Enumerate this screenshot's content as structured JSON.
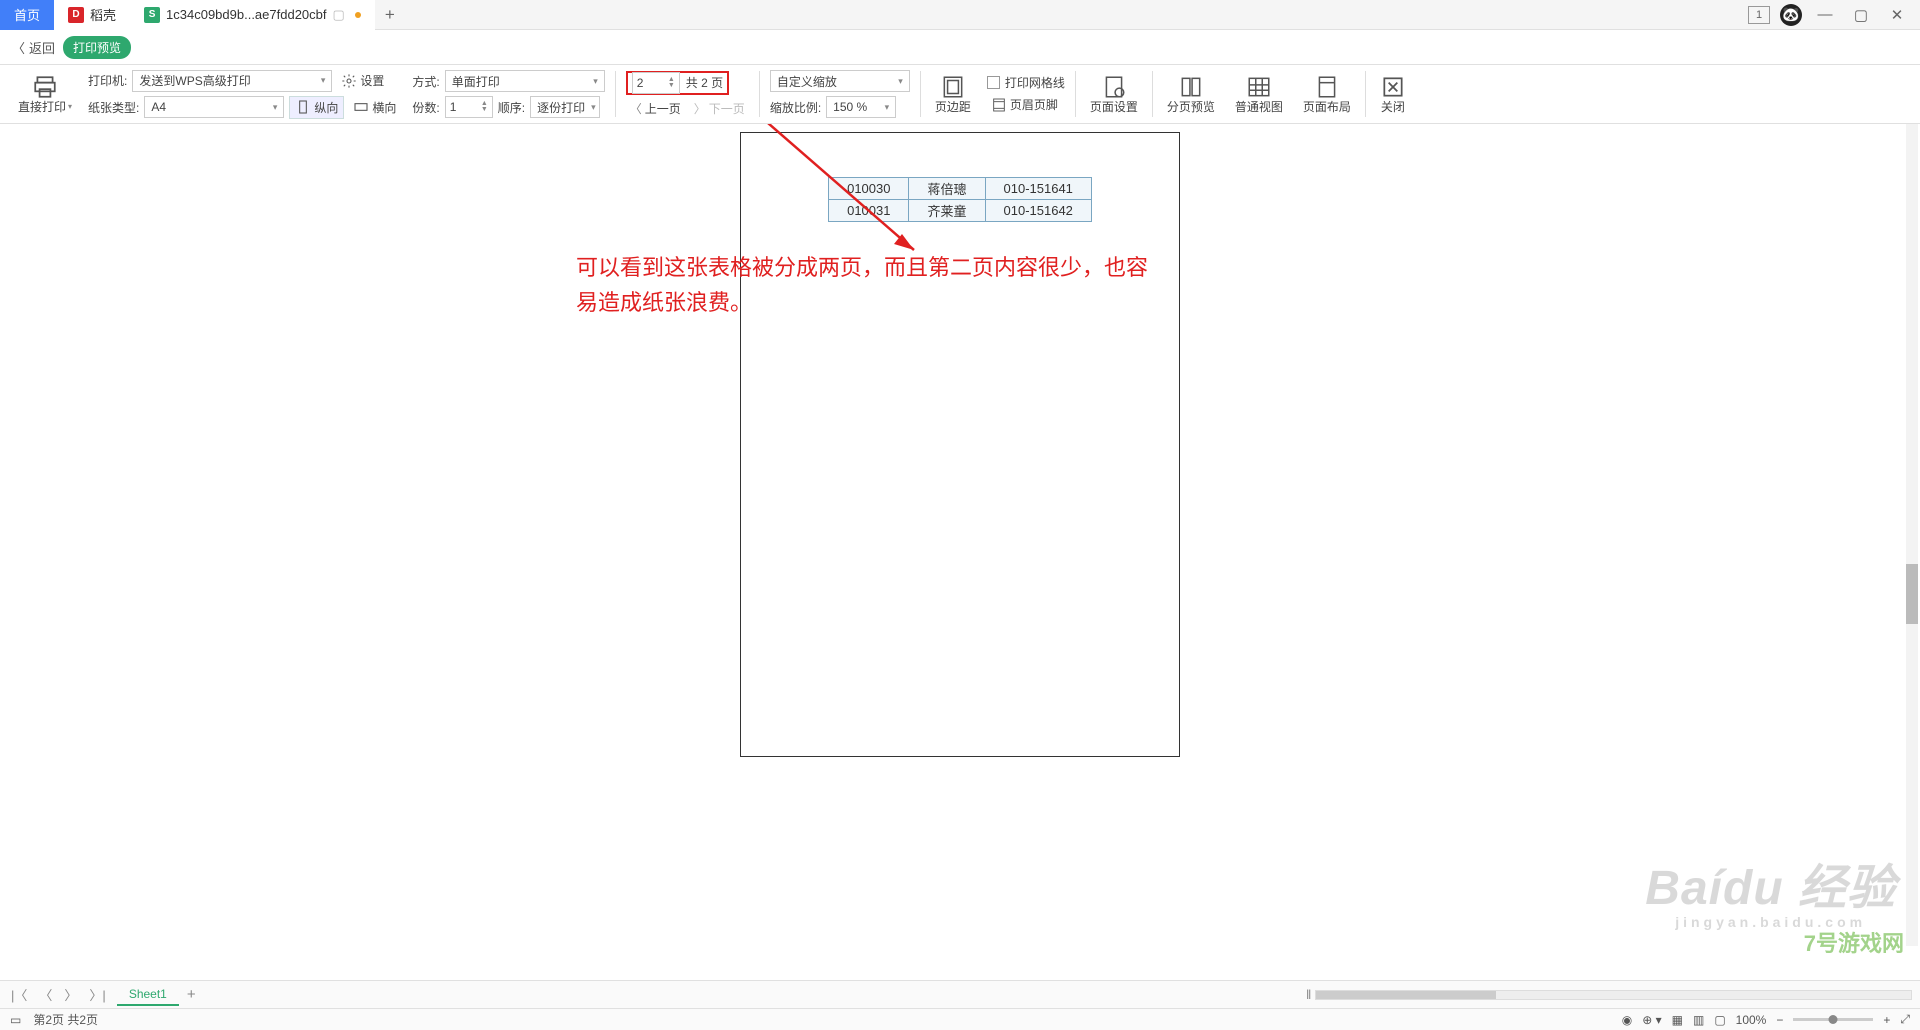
{
  "tabs": {
    "home": "首页",
    "doke": "稻壳",
    "file": "1c34c09bd9b...ae7fdd20cbf"
  },
  "window_buttons": {
    "one_badge": "1"
  },
  "backrow": {
    "back": "返回",
    "preview_badge": "打印预览"
  },
  "toolbar": {
    "direct_print": "直接打印",
    "printer_label": "打印机:",
    "printer_value": "发送到WPS高级打印",
    "paper_label": "纸张类型:",
    "paper_value": "A4",
    "settings": "设置",
    "portrait": "纵向",
    "landscape": "横向",
    "mode_label": "方式:",
    "mode_value": "单面打印",
    "copies_label": "份数:",
    "copies_value": "1",
    "order_label": "顺序:",
    "order_value": "逐份打印",
    "page_current": "2",
    "page_total_label": "共 2 页",
    "prev_page": "上一页",
    "next_page": "下一页",
    "zoom_mode": "自定义缩放",
    "zoom_ratio_label": "缩放比例:",
    "zoom_ratio_value": "150 %",
    "grid_check": "打印网格线",
    "margins": "页边距",
    "header_footer": "页眉页脚",
    "page_setup": "页面设置",
    "page_break": "分页预览",
    "normal_view": "普通视图",
    "page_layout": "页面布局",
    "close": "关闭"
  },
  "preview_table": {
    "rows": [
      {
        "c1": "010030",
        "c2": "蒋倍璁",
        "c3": "010-151641"
      },
      {
        "c1": "010031",
        "c2": "齐莱童",
        "c3": "010-151642"
      }
    ]
  },
  "annotation": {
    "line1": "可以看到这张表格被分成两页，而且第二页内容很少，也容",
    "line2": "易造成纸张浪费。"
  },
  "sheet": {
    "name": "Sheet1"
  },
  "status": {
    "page_info": "第2页 共2页",
    "zoom": "100%"
  },
  "watermarks": {
    "baidu": "Baidu",
    "jingyan": "经验",
    "url": "jingyan.baidu.com",
    "site7": "7号游戏网"
  }
}
